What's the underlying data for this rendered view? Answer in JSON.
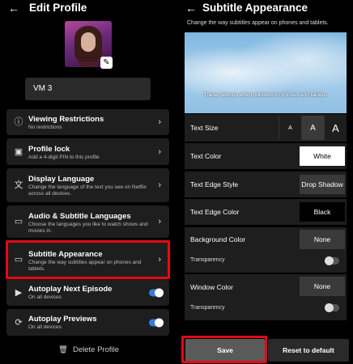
{
  "left": {
    "title": "Edit Profile",
    "profile_name": "VM 3",
    "rows": [
      {
        "title": "Viewing Restrictions",
        "subtitle": "No restrictions",
        "icon": "info-icon",
        "glyph": "ⓘ"
      },
      {
        "title": "Profile lock",
        "subtitle": "Add a 4-digit PIN to this profile",
        "icon": "lock-icon",
        "glyph": "🔒"
      },
      {
        "title": "Display Language",
        "subtitle": "Change the language of the text you see on Netflix across all devices.",
        "icon": "translate-icon",
        "glyph": "文"
      },
      {
        "title": "Audio & Subtitle Languages",
        "subtitle": "Choose the languages you like to watch shows and movies in.",
        "icon": "subtitles-icon",
        "glyph": "▭"
      },
      {
        "title": "Subtitle Appearance",
        "subtitle": "Change the way subtitles appear on phones and tablets.",
        "icon": "subtitle-style-icon",
        "glyph": "▭"
      },
      {
        "title": "Autoplay Next Episode",
        "subtitle": "On all devices",
        "icon": "autoplay-icon",
        "glyph": "▶"
      },
      {
        "title": "Autoplay Previews",
        "subtitle": "On all devices",
        "icon": "refresh-icon",
        "glyph": "⟳"
      }
    ],
    "delete_label": "Delete Profile"
  },
  "right": {
    "title": "Subtitle Appearance",
    "intro": "Change the way subtitles appear on phones and tablets.",
    "preview_caption": "These settings affect subtitles on phones and tablets.",
    "text_size": {
      "label": "Text Size",
      "options": [
        "A",
        "A",
        "A"
      ],
      "selected_index": 1
    },
    "text_color": {
      "label": "Text Color",
      "value": "White"
    },
    "text_edge_style": {
      "label": "Text Edge Style",
      "value": "Drop Shadow"
    },
    "text_edge_color": {
      "label": "Text Edge Color",
      "value": "Black"
    },
    "background_color": {
      "label": "Background Color",
      "value": "None",
      "transparency_label": "Transparency"
    },
    "window_color": {
      "label": "Window Color",
      "value": "None",
      "transparency_label": "Transparency"
    },
    "save_label": "Save",
    "reset_label": "Reset to default"
  },
  "colors": {
    "accent_red": "#e50914",
    "toggle_on": "#3a7bd5"
  }
}
